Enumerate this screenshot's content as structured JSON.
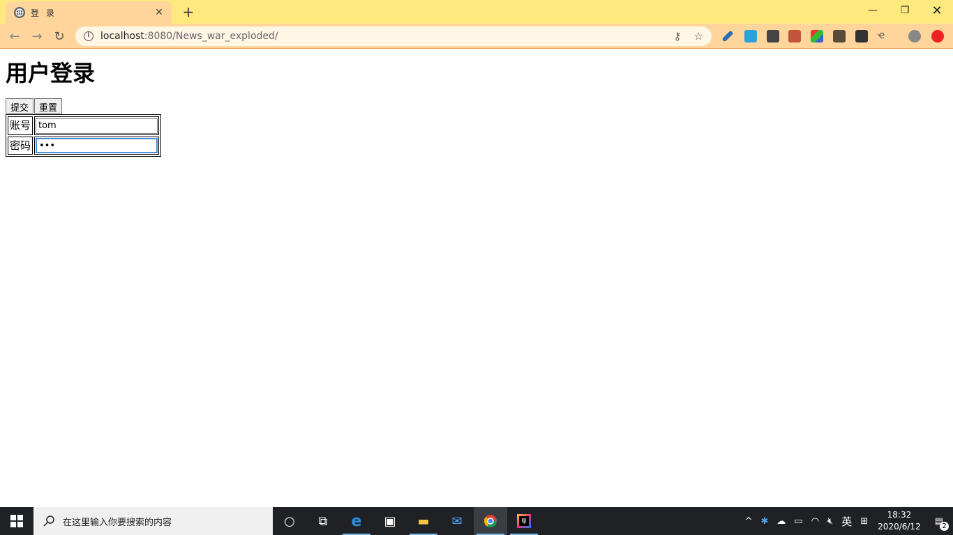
{
  "browser": {
    "tab_title": "登 录",
    "url_host": "localhost",
    "url_rest": ":8080/News_war_exploded/"
  },
  "page": {
    "heading": "用户登录",
    "submit_label": "提交",
    "reset_label": "重置",
    "account_label": "账号",
    "account_value": "tom",
    "password_label": "密码",
    "password_value": "123"
  },
  "taskbar": {
    "search_placeholder": "在这里输入你要搜索的内容",
    "ime": "英",
    "time": "18:32",
    "date": "2020/6/12",
    "notification_count": "2"
  },
  "colors": {
    "titlebar": "#fde97d",
    "toolbar": "#ffd59b",
    "taskbar": "#1f2125"
  }
}
